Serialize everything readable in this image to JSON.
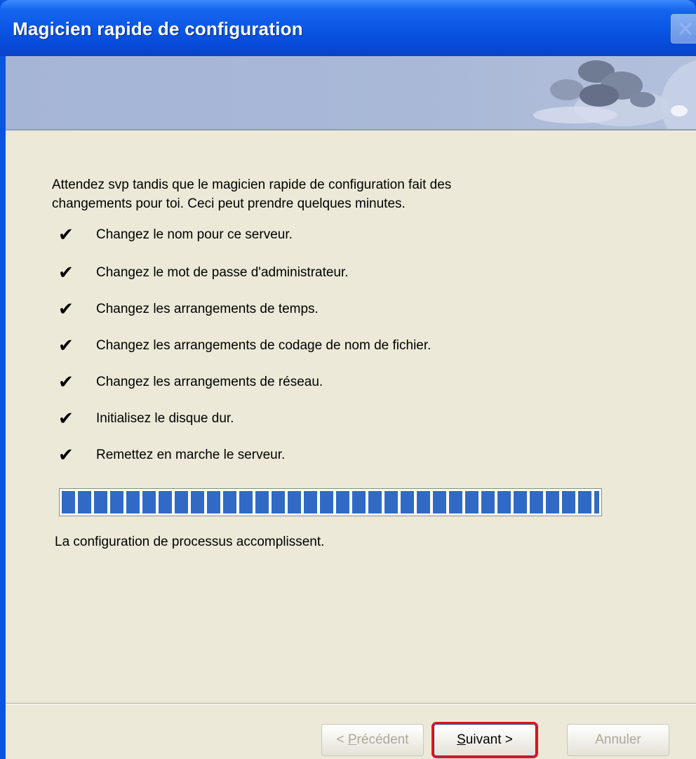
{
  "window": {
    "title": "Magicien rapide de configuration"
  },
  "intro": "Attendez svp tandis que le magicien rapide de configuration fait des\nchangements pour toi.  Ceci peut prendre quelques minutes.",
  "steps": [
    {
      "check": "✔",
      "label": "Changez le nom pour ce serveur."
    },
    {
      "check": "✔",
      "label": "Changez le mot de passe d'administrateur."
    },
    {
      "check": "✔",
      "label": "Changez les arrangements de temps."
    },
    {
      "check": "✔",
      "label": "Changez les arrangements de codage de nom de fichier."
    },
    {
      "check": "✔",
      "label": "Changez les arrangements de réseau."
    },
    {
      "check": "✔",
      "label": "Initialisez le disque dur."
    },
    {
      "check": "✔",
      "label": "Remettez en marche le serveur."
    }
  ],
  "progress": {
    "percent": 100,
    "caption": "La configuration de processus accomplissent."
  },
  "buttons": {
    "back": {
      "prefix": "< ",
      "accel": "P",
      "rest": "récédent"
    },
    "next": {
      "accel": "S",
      "rest": "uivant >"
    },
    "cancel": "Annuler"
  },
  "colors": {
    "titlebar": "#0a55e3",
    "progress_fill": "#316ac5",
    "dialog_bg": "#ece9d8",
    "focus_outline": "#e8121c"
  },
  "icons": {
    "close": "close-icon",
    "check": "check-icon"
  }
}
